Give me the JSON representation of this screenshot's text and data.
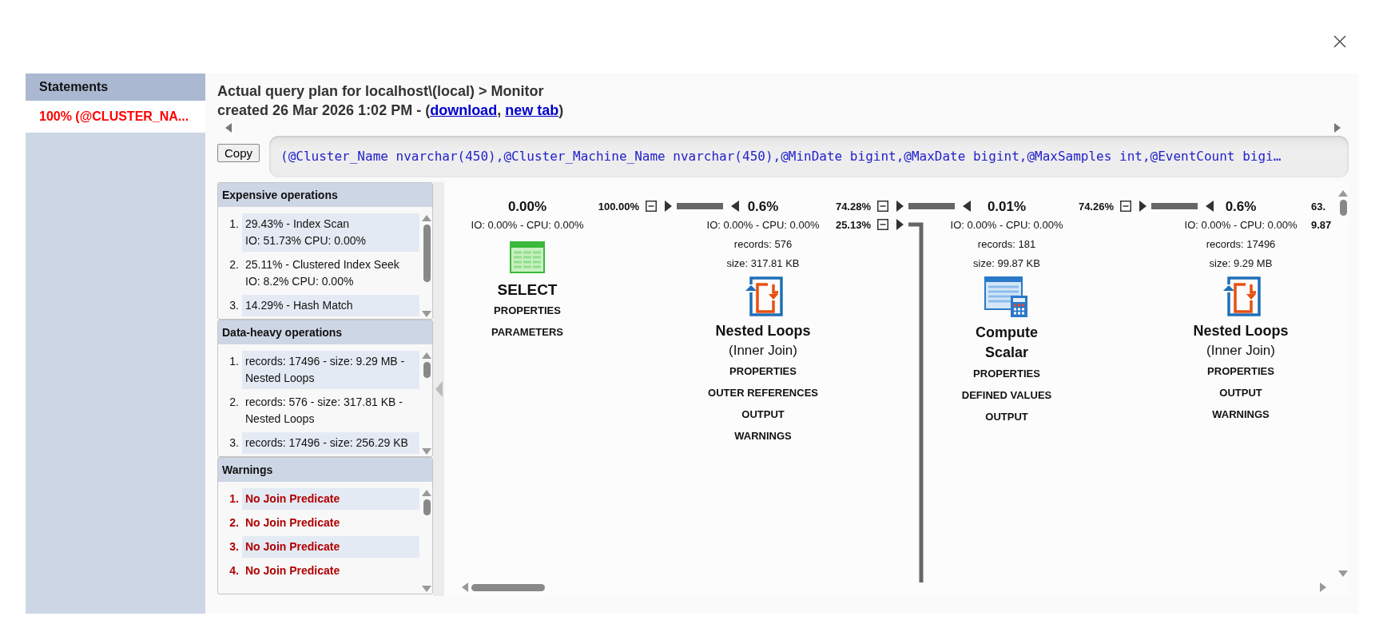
{
  "sidebar": {
    "header": "Statements",
    "items": [
      {
        "label": "100% (@CLUSTER_NA...",
        "selected": true
      }
    ]
  },
  "header": {
    "title": "Actual query plan for localhost\\(local) > Monitor",
    "created": "created 26 Mar 2026 1:02 PM - (",
    "links": [
      "download",
      "new tab"
    ],
    "separator": ", ",
    "suffix": ")"
  },
  "copy_button": "Copy",
  "query": "(@Cluster_Name nvarchar(450),@Cluster_Machine_Name nvarchar(450),@MinDate bigint,@MaxDate bigint,@MaxSamples int,@EventCount bigi…",
  "panels": [
    {
      "title": "Expensive operations",
      "kind": "normal",
      "items": [
        {
          "number": "1.",
          "lines": [
            "29.43% - Index Scan",
            "IO: 51.73% CPU: 0.00%"
          ]
        },
        {
          "number": "2.",
          "lines": [
            "25.11% - Clustered Index Seek",
            "IO: 8.2% CPU: 0.00%"
          ]
        },
        {
          "number": "3.",
          "lines": [
            "14.29% - Hash Match"
          ]
        }
      ]
    },
    {
      "title": "Data-heavy operations",
      "kind": "normal",
      "items": [
        {
          "number": "1.",
          "lines": [
            "records: 17496 - size: 9.29 MB - Nested Loops"
          ]
        },
        {
          "number": "2.",
          "lines": [
            "records: 576 - size: 317.81 KB - Nested Loops"
          ]
        },
        {
          "number": "3.",
          "lines": [
            "records: 17496 - size: 256.29 KB"
          ]
        }
      ]
    },
    {
      "title": "Warnings",
      "kind": "warning",
      "items": [
        {
          "number": "1.",
          "lines": [
            "No Join Predicate"
          ]
        },
        {
          "number": "2.",
          "lines": [
            "No Join Predicate"
          ]
        },
        {
          "number": "3.",
          "lines": [
            "No Join Predicate"
          ]
        },
        {
          "number": "4.",
          "lines": [
            "No Join Predicate"
          ]
        }
      ]
    }
  ],
  "plan": {
    "nodes": [
      {
        "kind": "select",
        "cost": "0.00%",
        "io_cpu": "IO: 0.00% - CPU: 0.00%",
        "title": "SELECT",
        "links": [
          "PROPERTIES",
          "PARAMETERS"
        ]
      },
      {
        "kind": "nested-loops",
        "cost": "0.6%",
        "io_cpu": "IO: 0.00% - CPU: 0.00%",
        "records": "records: 576",
        "size": "size: 317.81 KB",
        "title": "Nested Loops",
        "subtitle": "(Inner Join)",
        "links": [
          "PROPERTIES",
          "OUTER REFERENCES",
          "OUTPUT",
          "WARNINGS"
        ]
      },
      {
        "kind": "compute-scalar",
        "cost": "0.01%",
        "io_cpu": "IO: 0.00% - CPU: 0.00%",
        "records": "records: 181",
        "size": "size: 99.87 KB",
        "title": "Compute Scalar",
        "links": [
          "PROPERTIES",
          "DEFINED VALUES",
          "OUTPUT"
        ]
      },
      {
        "kind": "nested-loops",
        "cost": "0.6%",
        "io_cpu": "IO: 0.00% - CPU: 0.00%",
        "records": "records: 17496",
        "size": "size: 9.29 MB",
        "title": "Nested Loops",
        "subtitle": "(Inner Join)",
        "links": [
          "PROPERTIES",
          "OUTPUT",
          "WARNINGS"
        ]
      }
    ],
    "edges": [
      {
        "kind": "straight",
        "label": "100.00%",
        "expanded": true
      },
      {
        "kind": "straight",
        "label": "74.28%",
        "expanded": true
      },
      {
        "kind": "down",
        "label": "25.13%",
        "expanded": true
      },
      {
        "kind": "straight",
        "label": "74.26%",
        "expanded": true
      },
      {
        "kind": "cut",
        "label": "63."
      },
      {
        "kind": "cut",
        "label": "9.87"
      }
    ]
  }
}
